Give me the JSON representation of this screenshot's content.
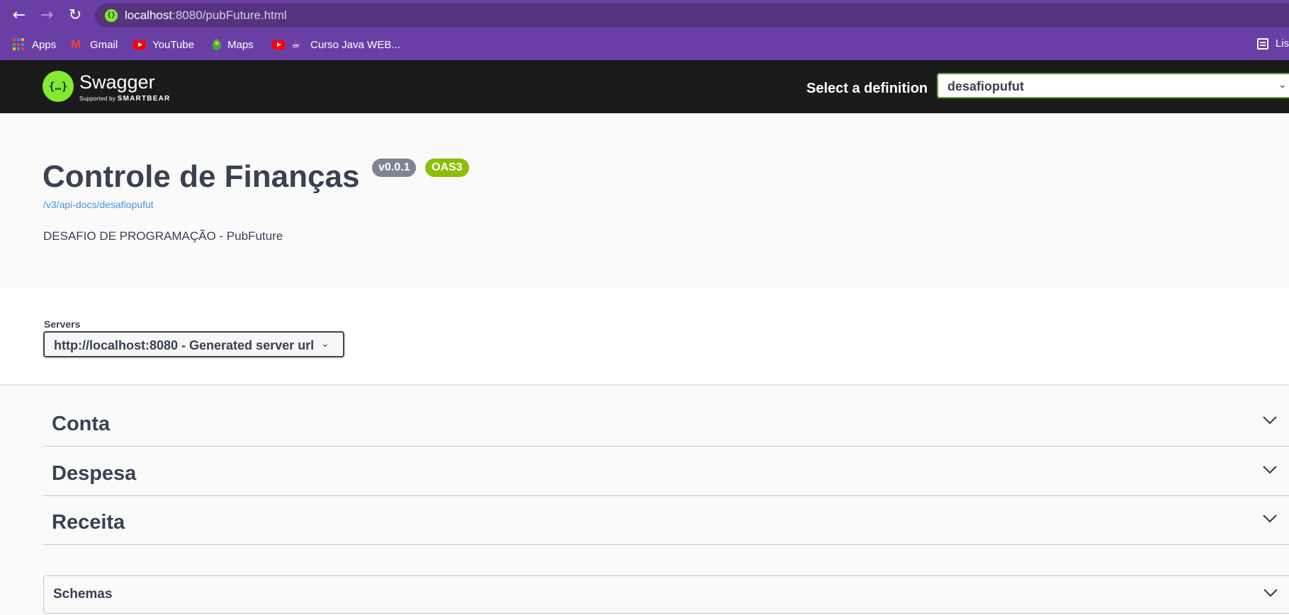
{
  "browser": {
    "url_host": "localhost",
    "url_path": ":8080/pubFuture.html",
    "bookmarks": [
      "Apps",
      "Gmail",
      "YouTube",
      "Maps",
      "Curso Java WEB..."
    ],
    "reading_list": "Lis"
  },
  "topbar": {
    "logo_title": "Swagger",
    "logo_sub_prefix": "Supported by",
    "logo_sub_brand": "SMARTBEAR",
    "select_label": "Select a definition",
    "selected_definition": "desafiopufut"
  },
  "info": {
    "title": "Controle de Finanças",
    "version": "v0.0.1",
    "oas": "OAS3",
    "link": "/v3/api-docs/desafiopufut",
    "description": "DESAFIO DE PROGRAMAÇÃO - PubFuture"
  },
  "servers": {
    "label": "Servers",
    "selected": "http://localhost:8080 - Generated server url"
  },
  "tags": [
    "Conta",
    "Despesa",
    "Receita"
  ],
  "schemas_label": "Schemas",
  "colors": {
    "browser_purple": "#6a3fa5",
    "swagger_green": "#85ea2d",
    "topbar_bg": "#1b1b1b",
    "oas_badge": "#89bf04",
    "version_badge": "#7d8492",
    "link_blue": "#4990e2"
  }
}
